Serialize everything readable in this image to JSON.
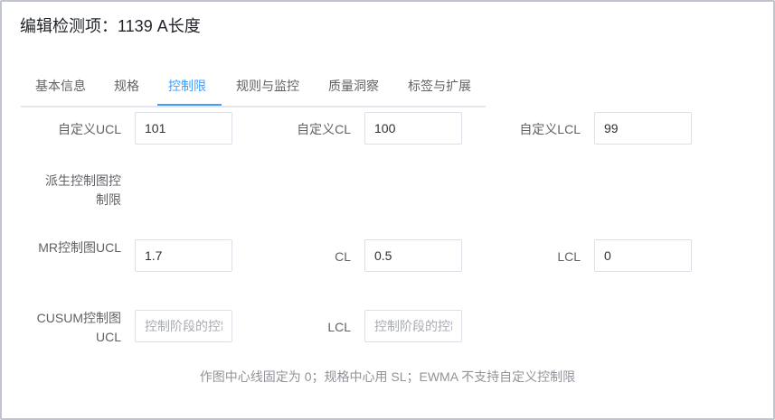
{
  "dialog": {
    "title": "编辑检测项：1139 A长度"
  },
  "tabs": [
    {
      "label": "基本信息"
    },
    {
      "label": "规格"
    },
    {
      "label": "控制限"
    },
    {
      "label": "规则与监控"
    },
    {
      "label": "质量洞察"
    },
    {
      "label": "标签与扩展"
    }
  ],
  "active_tab": "控制限",
  "custom": {
    "ucl_label": "自定义UCL",
    "ucl_value": "101",
    "cl_label": "自定义CL",
    "cl_value": "100",
    "lcl_label": "自定义LCL",
    "lcl_value": "99"
  },
  "derived": {
    "section_label": "派生控制图控制限"
  },
  "mr": {
    "ucl_label": "MR控制图UCL",
    "ucl_value": "1.7",
    "cl_label": "CL",
    "cl_value": "0.5",
    "lcl_label": "LCL",
    "lcl_value": "0"
  },
  "cusum": {
    "ucl_label": "CUSUM控制图 UCL",
    "ucl_placeholder": "控制阶段的控制限",
    "lcl_label": "LCL",
    "lcl_placeholder": "控制阶段的控制限"
  },
  "hint": "作图中心线固定为 0；规格中心用 SL；EWMA 不支持自定义控制限"
}
